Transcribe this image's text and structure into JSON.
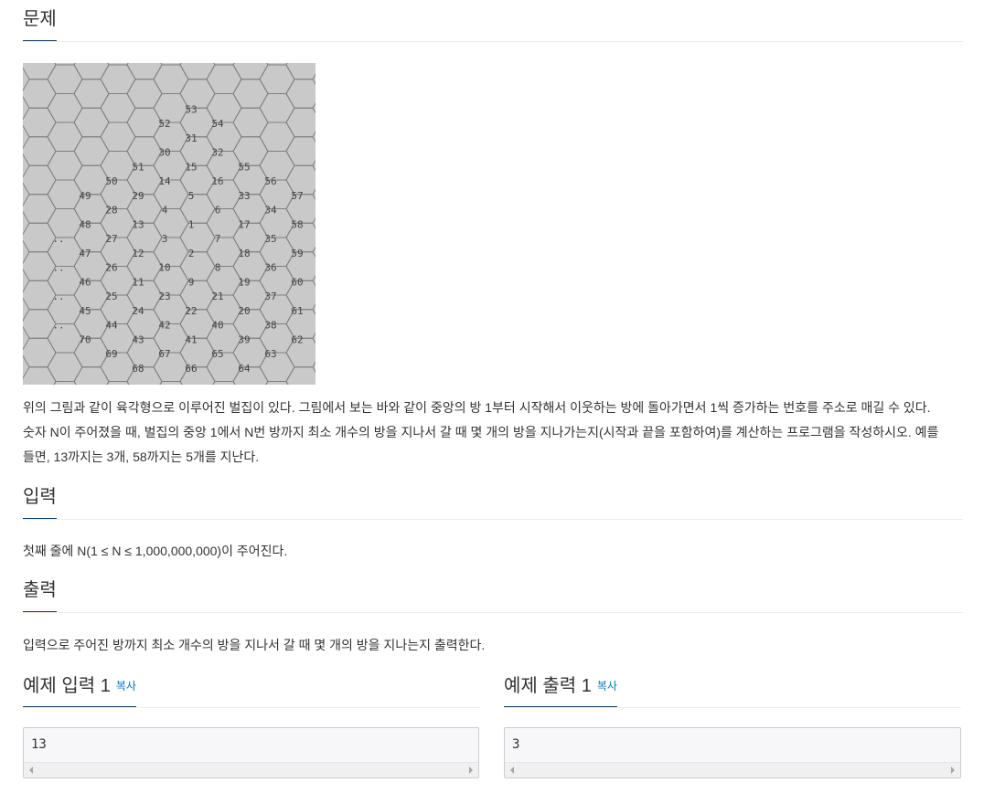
{
  "problem": {
    "heading": "문제",
    "lines": [
      "위의 그림과 같이 육각형으로 이루어진 벌집이 있다. 그림에서 보는 바와 같이 중앙의 방 1부터 시작해서 이웃하는 방에 돌아가면서 1씩 증가하는 번호를 주소로 매길 수 있다.",
      "숫자 N이 주어졌을 때, 벌집의 중앙 1에서 N번 방까지 최소 개수의 방을 지나서 갈 때 몇 개의 방을 지나가는지(시작과 끝을 포함하여)를 계산하는 프로그램을 작성하시오. 예를",
      "들면, 13까지는 3개, 58까지는 5개를 지난다."
    ]
  },
  "figure": {
    "cells": [
      {
        "label": "53"
      },
      {
        "label": "52"
      },
      {
        "label": "54"
      },
      {
        "label": "51"
      },
      {
        "label": "31"
      },
      {
        "label": "55"
      },
      {
        "label": "50"
      },
      {
        "label": "30"
      },
      {
        "label": "32"
      },
      {
        "label": "56"
      },
      {
        "label": "49"
      },
      {
        "label": "29"
      },
      {
        "label": "15"
      },
      {
        "label": "33"
      },
      {
        "label": "57"
      },
      {
        "label": "28"
      },
      {
        "label": "14"
      },
      {
        "label": "16"
      },
      {
        "label": "34"
      },
      {
        "label": "48"
      },
      {
        "label": "13"
      },
      {
        "label": "5"
      },
      {
        "label": "17"
      },
      {
        "label": "58"
      },
      {
        "label": ".."
      },
      {
        "label": "27"
      },
      {
        "label": "4"
      },
      {
        "label": "6"
      },
      {
        "label": "35"
      },
      {
        "label": "47"
      },
      {
        "label": "12"
      },
      {
        "label": "1"
      },
      {
        "label": "18"
      },
      {
        "label": "59"
      },
      {
        "label": ".."
      },
      {
        "label": "26"
      },
      {
        "label": "3"
      },
      {
        "label": "7"
      },
      {
        "label": "36"
      },
      {
        "label": "46"
      },
      {
        "label": "11"
      },
      {
        "label": "2"
      },
      {
        "label": "19"
      },
      {
        "label": "60"
      },
      {
        "label": ".."
      },
      {
        "label": "25"
      },
      {
        "label": "10"
      },
      {
        "label": "8"
      },
      {
        "label": "37"
      },
      {
        "label": "45"
      },
      {
        "label": "24"
      },
      {
        "label": "9"
      },
      {
        "label": "20"
      },
      {
        "label": "61"
      },
      {
        "label": ".."
      },
      {
        "label": "44"
      },
      {
        "label": "23"
      },
      {
        "label": "21"
      },
      {
        "label": "38"
      },
      {
        "label": "70"
      },
      {
        "label": "43"
      },
      {
        "label": "22"
      },
      {
        "label": "39"
      },
      {
        "label": "62"
      },
      {
        "label": "69"
      },
      {
        "label": "42"
      },
      {
        "label": "40"
      },
      {
        "label": "63"
      },
      {
        "label": "68"
      },
      {
        "label": "41"
      },
      {
        "label": "64"
      },
      {
        "label": "67"
      },
      {
        "label": "65"
      },
      {
        "label": "66"
      }
    ]
  },
  "input": {
    "heading": "입력",
    "text": "첫째 줄에 N(1 ≤ N ≤ 1,000,000,000)이 주어진다."
  },
  "output": {
    "heading": "출력",
    "text": "입력으로 주어진 방까지 최소 개수의 방을 지나서 갈 때 몇 개의 방을 지나는지 출력한다."
  },
  "samples": {
    "input_title": "예제 입력 1",
    "output_title": "예제 출력 1",
    "copy_label": "복사",
    "input_value": "13",
    "output_value": "3"
  }
}
